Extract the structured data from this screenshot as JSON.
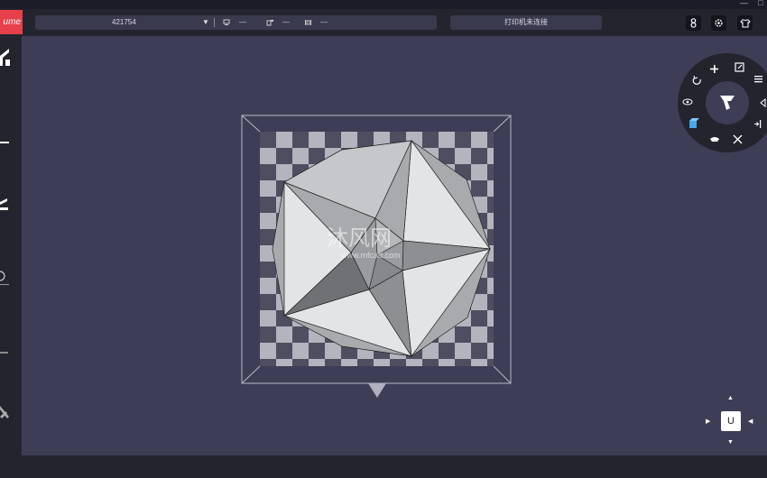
{
  "app": {
    "logo_text": "ume",
    "window_controls": [
      "—",
      "□"
    ]
  },
  "toolbar": {
    "model_name": "421754",
    "dropdown_glyph": "▼",
    "stats": [
      {
        "icon": "print-time-icon",
        "value": "—"
      },
      {
        "icon": "filament-icon",
        "value": "—"
      },
      {
        "icon": "dimensions-icon",
        "value": "—"
      }
    ],
    "printer_status": "打印机未连接",
    "right_buttons": [
      "account-icon",
      "settings-icon",
      "shirt-icon"
    ]
  },
  "sidebar": {
    "items": [
      "home-icon",
      "slice-icon",
      "edit-icon",
      "search-icon",
      "ruler-icon",
      "tools-icon"
    ]
  },
  "viewport": {
    "watermark_text": "沐风网",
    "watermark_url": "www.mfcad.com",
    "plate_colors": {
      "light": "#b4b4be",
      "dark": "#4e4e60"
    },
    "model_colors": {
      "light": "#e2e4e6",
      "mid": "#a8aaae",
      "dark": "#6f7175"
    }
  },
  "radial_menu": {
    "items": [
      "add-icon",
      "scale-icon",
      "layers-icon",
      "rotate-icon",
      "view-icon",
      "mirror-icon",
      "cube-icon",
      "support-icon",
      "move-icon",
      "split-icon"
    ],
    "center": "brush-icon"
  },
  "view_cube": {
    "label": "U",
    "arrows": [
      "▲",
      "◀",
      "▶",
      "▼"
    ]
  }
}
